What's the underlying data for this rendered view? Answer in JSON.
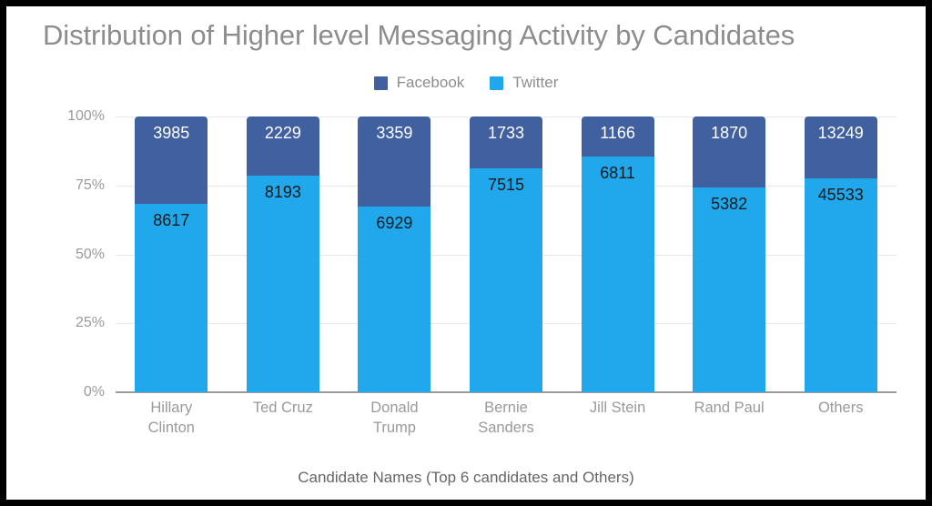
{
  "chart_data": {
    "type": "bar",
    "subtype": "stacked-percent",
    "title": "Distribution of Higher level Messaging Activity by Candidates",
    "xlabel": "Candidate Names (Top 6 candidates and Others)",
    "ylabel": "",
    "categories": [
      "Hillary Clinton",
      "Ted Cruz",
      "Donald Trump",
      "Bernie Sanders",
      "Jill Stein",
      "Rand Paul",
      "Others"
    ],
    "category_lines": [
      [
        "Hillary",
        "Clinton"
      ],
      [
        "Ted Cruz"
      ],
      [
        "Donald",
        "Trump"
      ],
      [
        "Bernie",
        "Sanders"
      ],
      [
        "Jill Stein"
      ],
      [
        "Rand Paul"
      ],
      [
        "Others"
      ]
    ],
    "series": [
      {
        "name": "Facebook",
        "color": "#40609f",
        "values": [
          3985,
          2229,
          3359,
          1733,
          1166,
          1870,
          13249
        ],
        "percents": [
          31.6,
          21.4,
          32.6,
          18.7,
          14.6,
          25.8,
          22.5
        ]
      },
      {
        "name": "Twitter",
        "color": "#21a7ec",
        "values": [
          8617,
          8193,
          6929,
          7515,
          6811,
          5382,
          45533
        ],
        "percents": [
          68.4,
          78.6,
          67.4,
          81.3,
          85.4,
          74.2,
          77.5
        ]
      }
    ],
    "ylim": [
      0,
      100
    ],
    "yticks": [
      "0%",
      "25%",
      "50%",
      "75%",
      "100%"
    ],
    "ytick_values": [
      0,
      25,
      50,
      75,
      100
    ],
    "grid": true,
    "legend_position": "top-center"
  },
  "legend": {
    "items": [
      {
        "label": "Facebook",
        "color": "#40609f"
      },
      {
        "label": "Twitter",
        "color": "#21a7ec"
      }
    ]
  },
  "colors": {
    "facebook": "#40609f",
    "twitter": "#21a7ec",
    "title_text": "#8d8d8d",
    "tick_text": "#9a9a9a",
    "axis_title_text": "#666666",
    "gridline": "#e8e8e8",
    "zero_axis": "#9b9b9b",
    "frame": "#000000",
    "background": "#ffffff"
  }
}
